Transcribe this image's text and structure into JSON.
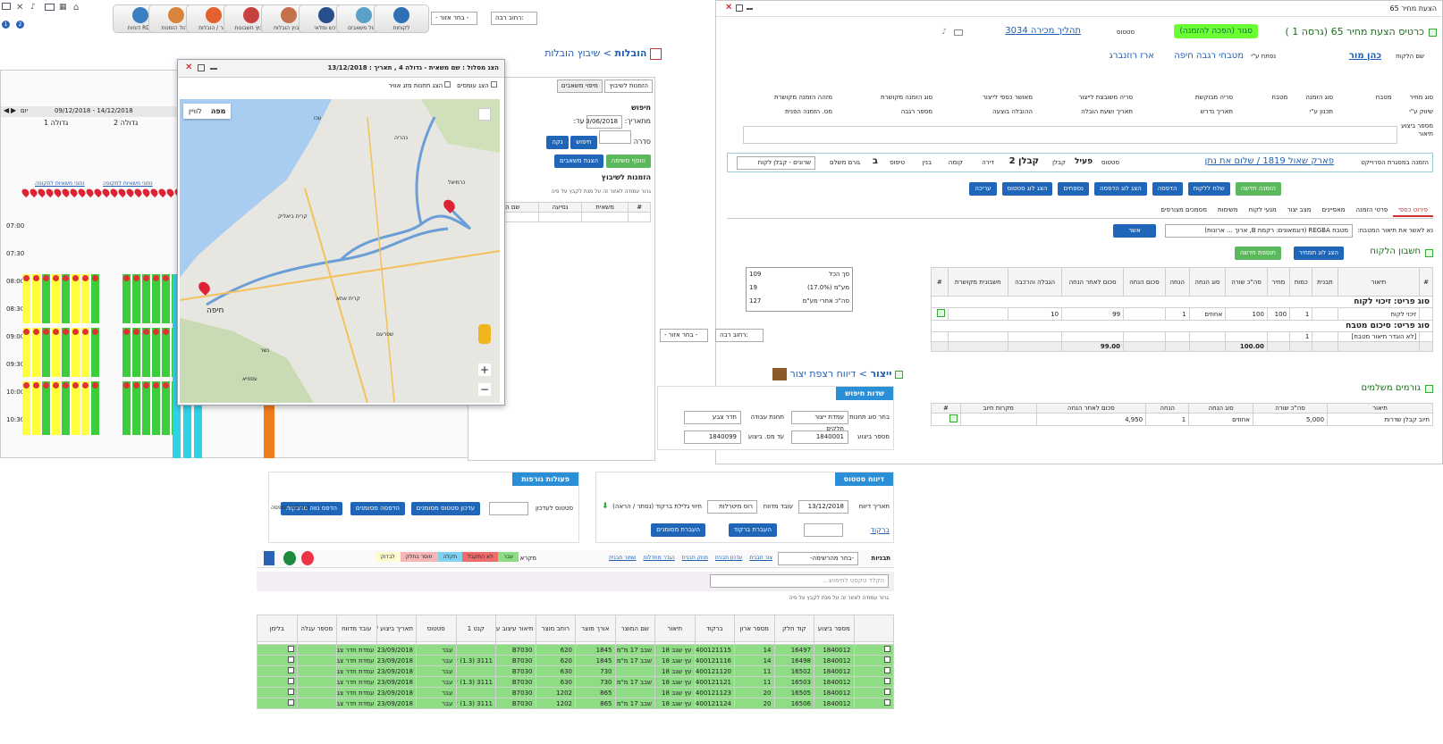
{
  "left_app": {
    "toolbar": {
      "modules": [
        "דוחות RDL",
        "לקוחות",
        "סיכום מעקבים",
        "יצור / הובלות",
        "ניהול הזמנות",
        "פיננס / הנהלת",
        "שיבוץ הובלות",
        "שיבוץ חשבונות",
        "רכש ומלאי",
        "ניהול משאבים"
      ],
      "site_select": "- בחר אזור -",
      "site_label": "רחוב רבה:"
    },
    "breadcrumb": {
      "module": "הובלות",
      "page": "שיבוץ הובלות"
    },
    "schedule": {
      "date_range": "09/12/2018 - 14/12/2018",
      "view": "יום",
      "trucks": [
        "גדולה 1",
        "גדולה 2"
      ],
      "links": [
        "נתוני משאיות לתקופה",
        "נתוני משאיות לתקופה"
      ],
      "times": [
        "07:00",
        "07:30",
        "08:00",
        "08:30",
        "09:00",
        "09:30",
        "10:00",
        "10:30"
      ]
    },
    "orders_panel": {
      "tabs": [
        "הזמנות לשיבוץ",
        "מיפוי משאבים"
      ],
      "search_title": "חיפוש",
      "from_label": "מתאריך:",
      "to_label": "עד:",
      "date_value": "3/06/2018",
      "series_label": "סדרה",
      "btn_search": "חיפוש",
      "btn_clear": "נקה",
      "btn_add": "הוסף משימה",
      "btn_show": "הצגת משאבים",
      "list_title": "הזמנות לשיבוץ",
      "hint": "גרור עמודה לאזור זה על מנת לקבץ על פיה",
      "cols": [
        "#",
        "משאית",
        "נסיעה",
        "שם הלקוח"
      ]
    },
    "route_window": {
      "title": "הצג מסלול : שם משאית - גדולה 4 , תאריך : 13/12/2018",
      "opt1": "הצג עומסים",
      "opt2": "הצג תחנות מזג אוויר",
      "map_tabs": [
        "מפה",
        "לוויין"
      ],
      "places": [
        "חיפה",
        "קרית ביאליק",
        "עכו",
        "כרמיאל",
        "נשר",
        "קרית אתא",
        "שפרעם",
        "נהריה",
        "עספיא"
      ]
    }
  },
  "quote_window": {
    "title": "הצעת מחיר 65",
    "header": {
      "title": "כרטיס הצעת מחיר 65 (גרסה 1 )",
      "status_badge": "סגור (הפכה להזמנה)",
      "status_label": "סטטוס",
      "sale_process": "תהליך מכירה 3034",
      "customer_label": "שם הלקוח",
      "customer": "כהן מור",
      "contact_label": "נפתח ע\"י",
      "contact": "מטבחי רגבה חיפה",
      "agent": "ארז רוזנברג"
    },
    "fields": [
      [
        "סוג מחיר",
        "מטבח"
      ],
      [
        "סוג הזמנה",
        "מטבח"
      ],
      [
        "סריה מבוקשת",
        ""
      ],
      [
        "סריה משובצת לייצור",
        ""
      ],
      [
        "מאושר כספי לייצור",
        ""
      ],
      [
        "סוג הזמנה מקושרת",
        ""
      ],
      [
        "מזהה הזמנה מקושרת",
        ""
      ],
      [
        "שיווק ע\"י",
        ""
      ],
      [
        "תכנון ע\"י",
        ""
      ],
      [
        "תאריך נדרש",
        ""
      ],
      [
        "תאריך ושעת הובלה",
        ""
      ],
      [
        "ההובלה בוצעה",
        ""
      ],
      [
        "מספר רגבה",
        ""
      ],
      [
        "מס. הזמנה הפנית",
        ""
      ],
      [
        "מספר ביצוע",
        ""
      ]
    ],
    "notes_label": "תיאור",
    "project": {
      "label": "הזמנה במסגרת הפרוייקט",
      "address": "פארק שאול 1819 / שלום את נתן",
      "status_label": "סטטוס",
      "status": "פעיל",
      "contractor_label": "קבלן",
      "contractor": "קבלן 2",
      "floor_label": "קומה",
      "apt_label": "דירה",
      "building_label": "בנין",
      "type_label": "טיפוס",
      "type": "ב",
      "payer_label": "גורם משלם",
      "payer": "שרונים - קבלן לקוח"
    },
    "actions": [
      "הזמנה חדשה",
      "שלח ללקוח",
      "הדפסה",
      "הצג לוג הדפסה",
      "נספחים",
      "הצג לוג סטטוס",
      "עריכה"
    ],
    "tabs": [
      "פירוט כספי",
      "פרטי הזמנה",
      "מאפיינים",
      "מצב יצור",
      "מגעי לקוח",
      "משימות",
      "מסמכים מצורפים"
    ],
    "kitchen_desc_label": "נא לאשר את תיאור המטבח:",
    "kitchen_desc": "מטבח REGBA (דוגמאונים: רקמת B, ארוך ... ארונות)",
    "approve": "אשר",
    "account": {
      "title": "חשבון הלקוח",
      "log_btn": "הצג לוג תמחיר",
      "new_btn": "תוספת חדשה",
      "cols": [
        "#",
        "תיאור",
        "תבנית",
        "כמות",
        "מחיר",
        "סה\"כ שורה",
        "סוג הנחה",
        "הנחה",
        "סכום הנחה",
        "סכום לאחר הנחה",
        "הגבלה והרכבה",
        "חשבונית מקושרת",
        "#"
      ],
      "group1": "סוג פריט: זיכוי לקוח",
      "row1": {
        "desc": "זיכוי לקוח",
        "qty": "1",
        "price": "100",
        "total": "100",
        "disc_type": "אחוזים",
        "disc": "1",
        "after": "99",
        "install": "10"
      },
      "group2": "סוג פריט: סיכום מטבח",
      "row2": {
        "desc": "[לא הוגדר תיאור מטבח]",
        "qty": "1"
      },
      "sum_after": "99.00",
      "sum_total": "100.00",
      "summary": [
        [
          "סך הכל",
          "109"
        ],
        [
          "מע\"מ (17.0%)",
          "19"
        ],
        [
          "סה\"כ אחרי מע\"מ",
          "127"
        ]
      ]
    },
    "payers": {
      "title": "גורמים משלמים",
      "cols": [
        "תיאור",
        "סה\"כ שורה",
        "סוג הנחה",
        "הנחה",
        "סכום לאחר הנחה",
        "מקרות חיוב",
        "#"
      ],
      "row": {
        "desc": "חיוב קבלן שדרות",
        "total": "5,000",
        "disc_type": "אחוזים",
        "disc": "1",
        "after": "4,950"
      }
    }
  },
  "production_report": {
    "breadcrumb": {
      "module": "ייצור",
      "page": "דיווח רצפת יצור"
    },
    "site_label": "רחוב רבה:",
    "site_select": "- בחר אזור -",
    "search": {
      "title": "שדות חיפוש",
      "group_label": "בחר סוג תחנות",
      "group_value": "עמדת ייצור חלקים",
      "station_label": "תחנת עבודה",
      "station_value": "חדר צבע",
      "from_label": "מספר ביצוע",
      "from_value": "1840001",
      "to_label": "עד מס. ביצוע",
      "to_value": "1840099"
    },
    "status_box": {
      "title": "דיווח סטטוס",
      "date_label": "תאריך דיווח",
      "date": "13/12/2018",
      "worker_label": "עובד מדווח",
      "worker": "רוס מיטרלות",
      "pallet_label": "חיווי גלילת ברקוד (נסתר / הראה)",
      "barcode": "ברקוד",
      "btn_barcode": "העברת ברקוד",
      "btn_marked": "העברת מסומנים"
    },
    "mass_box": {
      "title": "פעולות גורפות",
      "status_label": "סטטוס לעדכון",
      "btn_update": "עדכון סטטוס מסומנים",
      "btn_print": "הדפסה מסומנים",
      "btn_print2": "הדפס נווה מדבקות",
      "pre_print": "נצא לפני הדפסה"
    },
    "toolbar": {
      "views_label": "תבניות",
      "views_select": "-בחר מהרשימה-",
      "links": [
        "צור תבנית",
        "עדכון תבנית",
        "מחק תבנית",
        "הגדר מחדלות",
        "שמור תבנית"
      ],
      "legend_label": "מקרא",
      "legend": [
        [
          "עבר",
          "#8edc84"
        ],
        [
          "לא התקבל",
          "#f06b6b"
        ],
        [
          "תקלה",
          "#7fd3ee"
        ],
        [
          "חוסר בחלק",
          "#f4b6b6"
        ],
        [
          "לבדוק",
          "#fffbd0"
        ]
      ]
    },
    "filter_placeholder": "הקלד טקסט לחיפוש...",
    "hint": "גרור עמודה לאזור זה על מנת לקבץ על פיה",
    "cols": [
      "מספר ביצוע",
      "קוד חלק",
      "מספר ארון",
      "ברקוד",
      "תיאור",
      "שם המוצר",
      "אורך מוצר",
      "רוחב מוצר",
      "תיאור עיצוב עליון",
      "קנט 1",
      "סטטוס",
      "תאריך ביצוע / דיווח",
      "עובד מדווח",
      "מספר עגלה",
      "בלימן"
    ],
    "rows": [
      [
        "1840012",
        "16497",
        "14",
        "400121115",
        "עץ שגב 18",
        "שבב 17 מ\"מ 2100",
        "1845",
        "620",
        "B7030",
        "",
        "עבר",
        "23/09/2018 (22",
        "עמדת חדר צבע",
        "",
        ""
      ],
      [
        "1840012",
        "16498",
        "14",
        "400121116",
        "עץ שגב 18",
        "שבב 17 מ\"מ 2100",
        "1845",
        "620",
        "B7030",
        "3111 (1.3) לבנה",
        "עבר",
        "23/09/2018 (22",
        "עמדת חדר צבע",
        "",
        ""
      ],
      [
        "1840012",
        "16502",
        "11",
        "400121120",
        "עץ שגב 18",
        "",
        "730",
        "630",
        "B7030",
        "",
        "עבר",
        "23/09/2018 (22",
        "עמדת חדר צבע",
        "",
        ""
      ],
      [
        "1840012",
        "16503",
        "11",
        "400121121",
        "עץ שגב 18",
        "שבב 17 מ\"מ 2100",
        "730",
        "630",
        "B7030",
        "3111 (1.3) לבנה",
        "עבר",
        "23/09/2018 (22",
        "עמדת חדר צבע",
        "",
        ""
      ],
      [
        "1840012",
        "16505",
        "20",
        "400121123",
        "עץ שגב 18",
        "",
        "865",
        "1202",
        "B7030",
        "",
        "עבר",
        "23/09/2018 (22",
        "עמדת חדר צבע",
        "",
        ""
      ],
      [
        "1840012",
        "16506",
        "20",
        "400121124",
        "עץ שגב 18",
        "שבב 17 מ\"מ 2100",
        "865",
        "1202",
        "B7030",
        "3111 (1.3) לבנה",
        "עבר",
        "23/09/2018 (22",
        "עמדת חדר צבע",
        "",
        ""
      ]
    ]
  }
}
